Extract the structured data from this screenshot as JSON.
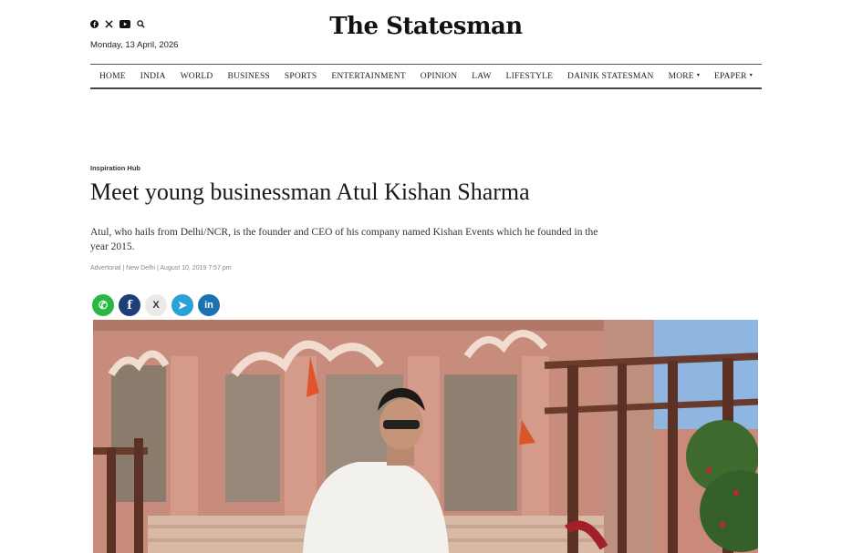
{
  "header": {
    "logo": "The Statesman",
    "date": "Monday, 13 April, 2026",
    "social_icons": [
      "facebook-icon",
      "x-icon",
      "youtube-icon",
      "search-icon"
    ]
  },
  "nav": {
    "items": [
      "HOME",
      "INDIA",
      "WORLD",
      "BUSINESS",
      "SPORTS",
      "ENTERTAINMENT",
      "OPINION",
      "LAW",
      "LIFESTYLE",
      "DAINIK STATESMAN",
      "MORE",
      "EPAPER"
    ],
    "dropdown_caret": "▾"
  },
  "article": {
    "kicker": "Inspiration Hub",
    "headline": "Meet young businessman Atul Kishan Sharma",
    "summary": "Atul, who hails from Delhi/NCR, is the founder and CEO of his company named Kishan Events which he founded in the year 2015.",
    "meta": "Advertorial | New Delhi | August 10, 2019 7:57 pm"
  },
  "share": {
    "buttons": [
      {
        "name": "whatsapp-share-icon",
        "glyph": "✆",
        "color": "#2bb741"
      },
      {
        "name": "facebook-share-icon",
        "glyph": "f",
        "color": "#1f3f7a"
      },
      {
        "name": "x-share-icon",
        "glyph": "X",
        "color": "#e9e9e9"
      },
      {
        "name": "telegram-share-icon",
        "glyph": "➤",
        "color": "#2aa1d8"
      },
      {
        "name": "linkedin-share-icon",
        "glyph": "in",
        "color": "#1a72b0"
      }
    ]
  },
  "colors": {
    "photo_building": "#c98a7a",
    "photo_sky": "#8fb6e0",
    "photo_railing": "#6a3b2c"
  }
}
